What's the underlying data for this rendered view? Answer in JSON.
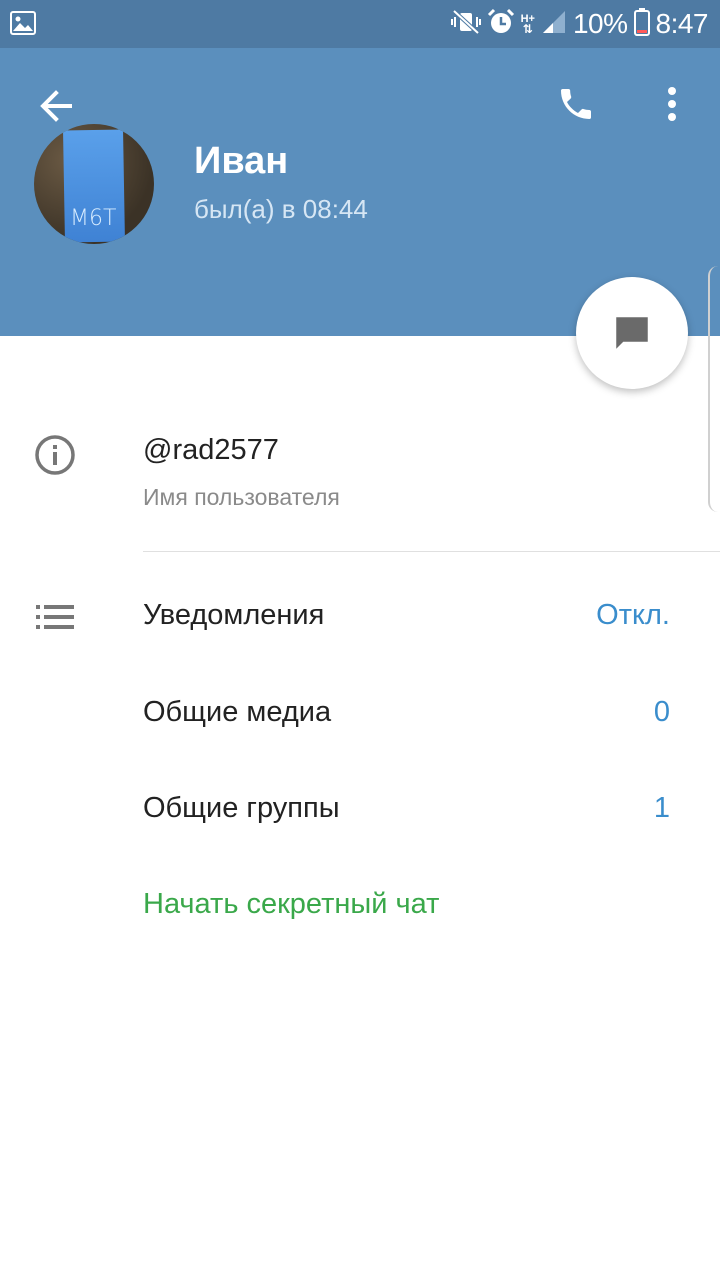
{
  "status_bar": {
    "network_top": "H+",
    "battery_percent": "10%",
    "time": "8:47",
    "icons": [
      "gallery-icon",
      "mute-vibrate-icon",
      "alarm-icon",
      "network-arrows-icon",
      "signal-icon",
      "battery-icon"
    ]
  },
  "header": {
    "background_color": "#5b8fbd",
    "back_icon": "arrow-left-icon",
    "call_icon": "phone-icon",
    "menu_icon": "more-vertical-icon"
  },
  "profile": {
    "name": "Иван",
    "last_seen": "был(а) в 08:44",
    "avatar_text": "M6T"
  },
  "fab": {
    "icon": "message-icon"
  },
  "info": {
    "username": "@rad2577",
    "username_caption": "Имя пользователя",
    "icon": "info-icon"
  },
  "settings": {
    "icon": "list-icon",
    "notifications": {
      "label": "Уведомления",
      "value": "Откл."
    },
    "shared_media": {
      "label": "Общие медиа",
      "value": "0"
    },
    "shared_groups": {
      "label": "Общие группы",
      "value": "1"
    },
    "secret_chat": "Начать секретный чат"
  },
  "colors": {
    "accent_blue": "#3a8dcc",
    "secret_green": "#3aa84a",
    "status_bar": "#4e7aa3"
  }
}
